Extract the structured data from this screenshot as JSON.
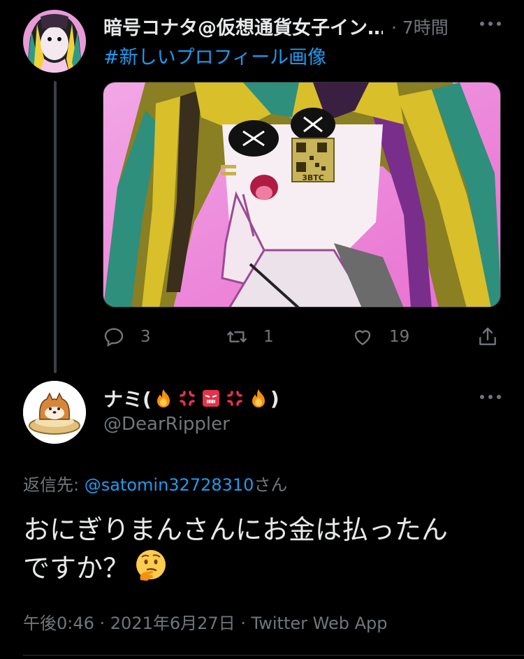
{
  "tweet1": {
    "author_name": "暗号コナタ@仮想通貨女子イン…",
    "time": "· 7時間",
    "hashtag": "#新しいプロフィール画像",
    "media_text": "3BTC",
    "reply_count": "3",
    "retweet_count": "1",
    "like_count": "19"
  },
  "tweet2": {
    "author_name_prefix": "ナミ(",
    "author_name_suffix": ")",
    "handle": "@DearRippler",
    "reply_to_label": "返信先: ",
    "reply_to_mention": "@satomin32728310",
    "reply_to_suffix": "さん",
    "text_line1": "おにぎりまんさんにお金は払ったん",
    "text_line2": "ですか？",
    "meta": "午後0:46 · 2021年6月27日 · Twitter Web App"
  },
  "colors": {
    "background": "#000000",
    "text_primary": "#e7e9ea",
    "text_secondary": "#71767b",
    "link": "#1d9bf0"
  },
  "icons": [
    "more-icon",
    "reply-icon",
    "retweet-icon",
    "like-icon",
    "share-icon",
    "fire-emoji",
    "anger-emoji",
    "angry-face-emoji",
    "thinking-face-emoji"
  ]
}
